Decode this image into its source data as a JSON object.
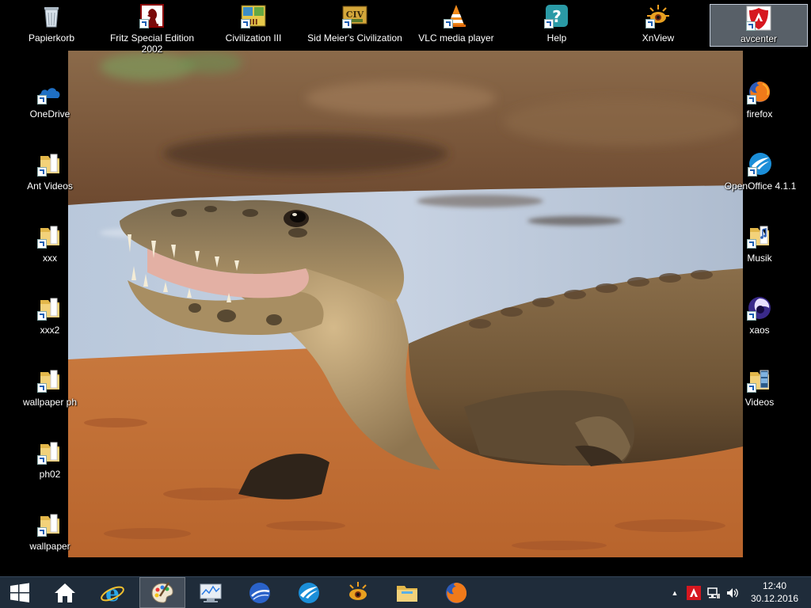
{
  "desktop": {
    "top_icons": [
      {
        "label": "Papierkorb",
        "icon": "recycle-bin-icon"
      },
      {
        "label": "Fritz Special Edition",
        "label2": "2002",
        "icon": "fritz-chess-icon"
      },
      {
        "label": "Civilization III",
        "icon": "civ3-icon"
      },
      {
        "label": "Sid Meier's Civilization",
        "icon": "civ-icon"
      },
      {
        "label": "VLC media player",
        "icon": "vlc-icon"
      },
      {
        "label": "Help",
        "icon": "help-icon"
      },
      {
        "label": "XnView",
        "icon": "xnview-icon"
      },
      {
        "label": "avcenter",
        "icon": "avira-icon",
        "selected": true
      }
    ],
    "left_icons": [
      {
        "label": "OneDrive",
        "icon": "onedrive-icon"
      },
      {
        "label": "Ant Videos",
        "icon": "folder-icon"
      },
      {
        "label": "xxx",
        "icon": "folder-icon"
      },
      {
        "label": "xxx2",
        "icon": "folder-icon"
      },
      {
        "label": "wallpaper ph",
        "icon": "folder-icon"
      },
      {
        "label": "ph02",
        "icon": "folder-icon"
      },
      {
        "label": "wallpaper",
        "icon": "folder-icon"
      }
    ],
    "right_icons": [
      {
        "label": "firefox",
        "icon": "firefox-icon"
      },
      {
        "label": "OpenOffice 4.1.1",
        "icon": "openoffice-icon"
      },
      {
        "label": "Musik",
        "icon": "music-folder-icon"
      },
      {
        "label": "xaos",
        "icon": "xaos-icon"
      },
      {
        "label": "Videos",
        "icon": "video-folder-icon"
      }
    ],
    "wallpaper": "caiman-wallpaper"
  },
  "taskbar": {
    "pinned": [
      {
        "name": "start",
        "icon": "windows-start-icon"
      },
      {
        "name": "home",
        "icon": "home-icon"
      },
      {
        "name": "internet-explorer",
        "icon": "internet-explorer-icon"
      },
      {
        "name": "paint",
        "icon": "paint-palette-icon",
        "active": true
      },
      {
        "name": "system-monitor",
        "icon": "monitor-chart-icon"
      },
      {
        "name": "google-earth",
        "icon": "google-earth-icon"
      },
      {
        "name": "openoffice",
        "icon": "openoffice-icon"
      },
      {
        "name": "xnview",
        "icon": "xnview-icon"
      },
      {
        "name": "file-explorer",
        "icon": "file-explorer-icon"
      },
      {
        "name": "firefox",
        "icon": "firefox-icon"
      }
    ],
    "tray": {
      "icons": [
        "show-hidden-icons-chevron",
        "avira-tray-icon",
        "network-icon",
        "volume-icon"
      ],
      "time": "12:40",
      "date": "30.12.2016"
    }
  },
  "colors": {
    "taskbar": "#1f2c3a",
    "desktop_background": "#000000",
    "selection": "#a0afbe"
  }
}
